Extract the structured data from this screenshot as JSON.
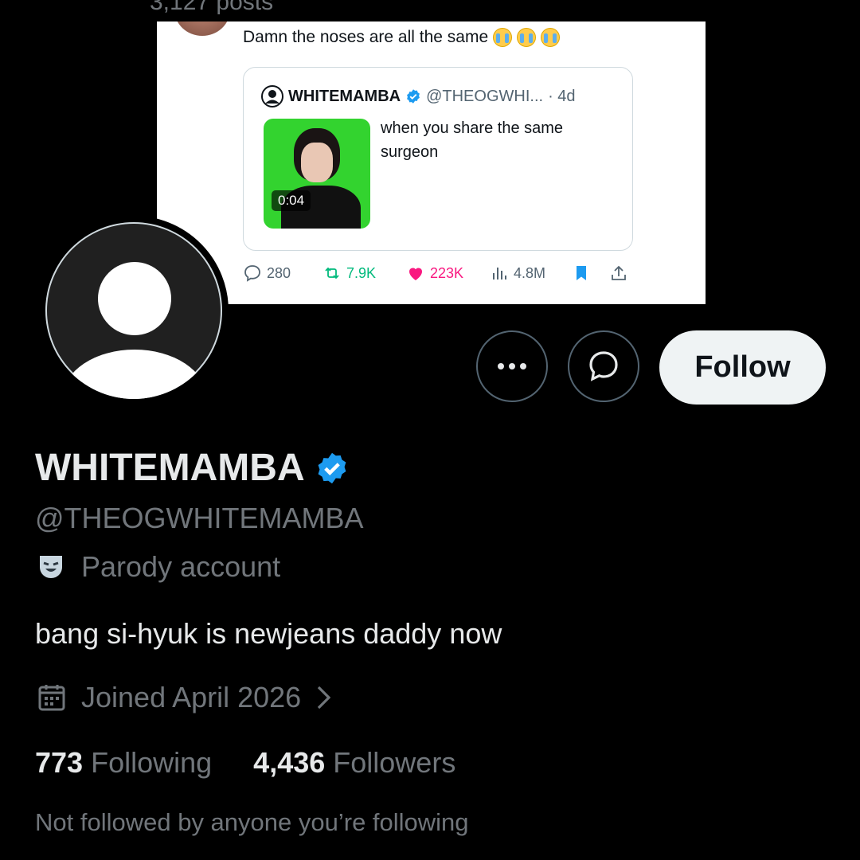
{
  "header": {
    "posts_cut": "3,127 posts"
  },
  "banner_tweet": {
    "reply_text": "Damn the noses are all the same",
    "quote": {
      "author_name": "WHITEMAMBA",
      "author_handle": "@THEOGWHI...",
      "age": "· 4d",
      "text": "when you share the same surgeon",
      "video_time": "0:04"
    },
    "stats": {
      "replies": "280",
      "reposts": "7.9K",
      "likes": "223K",
      "views": "4.8M"
    },
    "colors": {
      "repost": "#00ba7c",
      "like": "#f91880",
      "bookmark": "#1d9bf0",
      "verified": "#1d9bf0"
    }
  },
  "profile": {
    "display_name": "WHITEMAMBA",
    "handle": "@THEOGWHITEMAMBA",
    "label": "Parody account",
    "bio": "bang si-hyuk is newjeans daddy now",
    "joined": "Joined April 2026",
    "following_count": "773",
    "following_label": "Following",
    "followers_count": "4,436",
    "followers_label": "Followers",
    "mutuals_text": "Not followed by anyone you’re following"
  },
  "buttons": {
    "follow_label": "Follow",
    "more_icon": "more-icon",
    "message_icon": "message-icon"
  }
}
